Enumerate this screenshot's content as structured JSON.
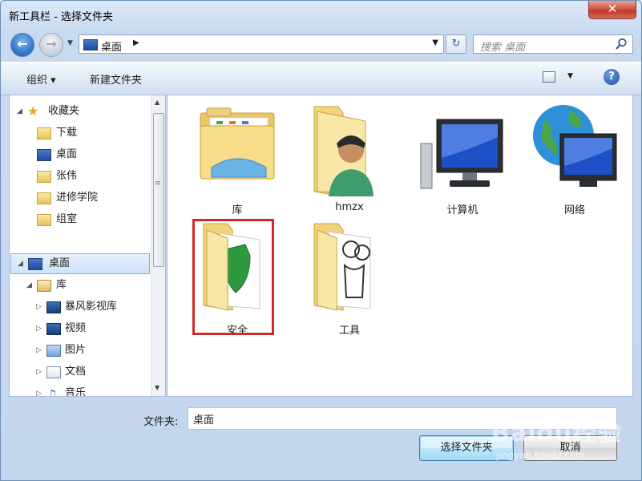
{
  "window": {
    "title": "新工具栏 - 选择文件夹",
    "close": "✕"
  },
  "address": {
    "location": "桌面",
    "breadcrumb_arrow": "▶",
    "dropdown": "▼",
    "refresh": "↻",
    "search_placeholder": "搜索 桌面"
  },
  "nav_buttons": {
    "back": "←",
    "forward": "→",
    "history": "▼"
  },
  "toolbar": {
    "organize": "组织 ▾",
    "new_folder": "新建文件夹",
    "view_dropdown": "▼",
    "help": "?"
  },
  "navpane": {
    "favorites": "收藏夹",
    "items": [
      "下载",
      "桌面",
      "张伟",
      "进修学院",
      "组室"
    ],
    "desktop_root": "桌面",
    "library": "库",
    "library_items": [
      "暴风影视库",
      "视频",
      "图片",
      "文档",
      "音乐"
    ]
  },
  "content": {
    "items": [
      "库",
      "hmzx",
      "计算机",
      "网络",
      "安全",
      "工具"
    ]
  },
  "bottom": {
    "folder_label": "文件夹:",
    "folder_value": "桌面",
    "ok": "选择文件夹",
    "cancel": "取消"
  },
  "watermark": {
    "brand": "Baidu经验",
    "url": "jingyan.baidu.com"
  },
  "icons": [
    "back-arrow-icon",
    "forward-arrow-icon",
    "desktop-icon",
    "refresh-icon",
    "search-icon",
    "view-icon",
    "help-icon",
    "star-icon",
    "folder-icon",
    "library-icon",
    "video-icon",
    "picture-icon",
    "document-icon",
    "music-icon",
    "user-folder-icon",
    "computer-icon",
    "network-icon",
    "shield-folder-icon",
    "tools-folder-icon"
  ],
  "colors": {
    "highlight": "#cf2a2a",
    "title_bar": "#dbe8f7",
    "ok_button": "#bee6fd"
  }
}
